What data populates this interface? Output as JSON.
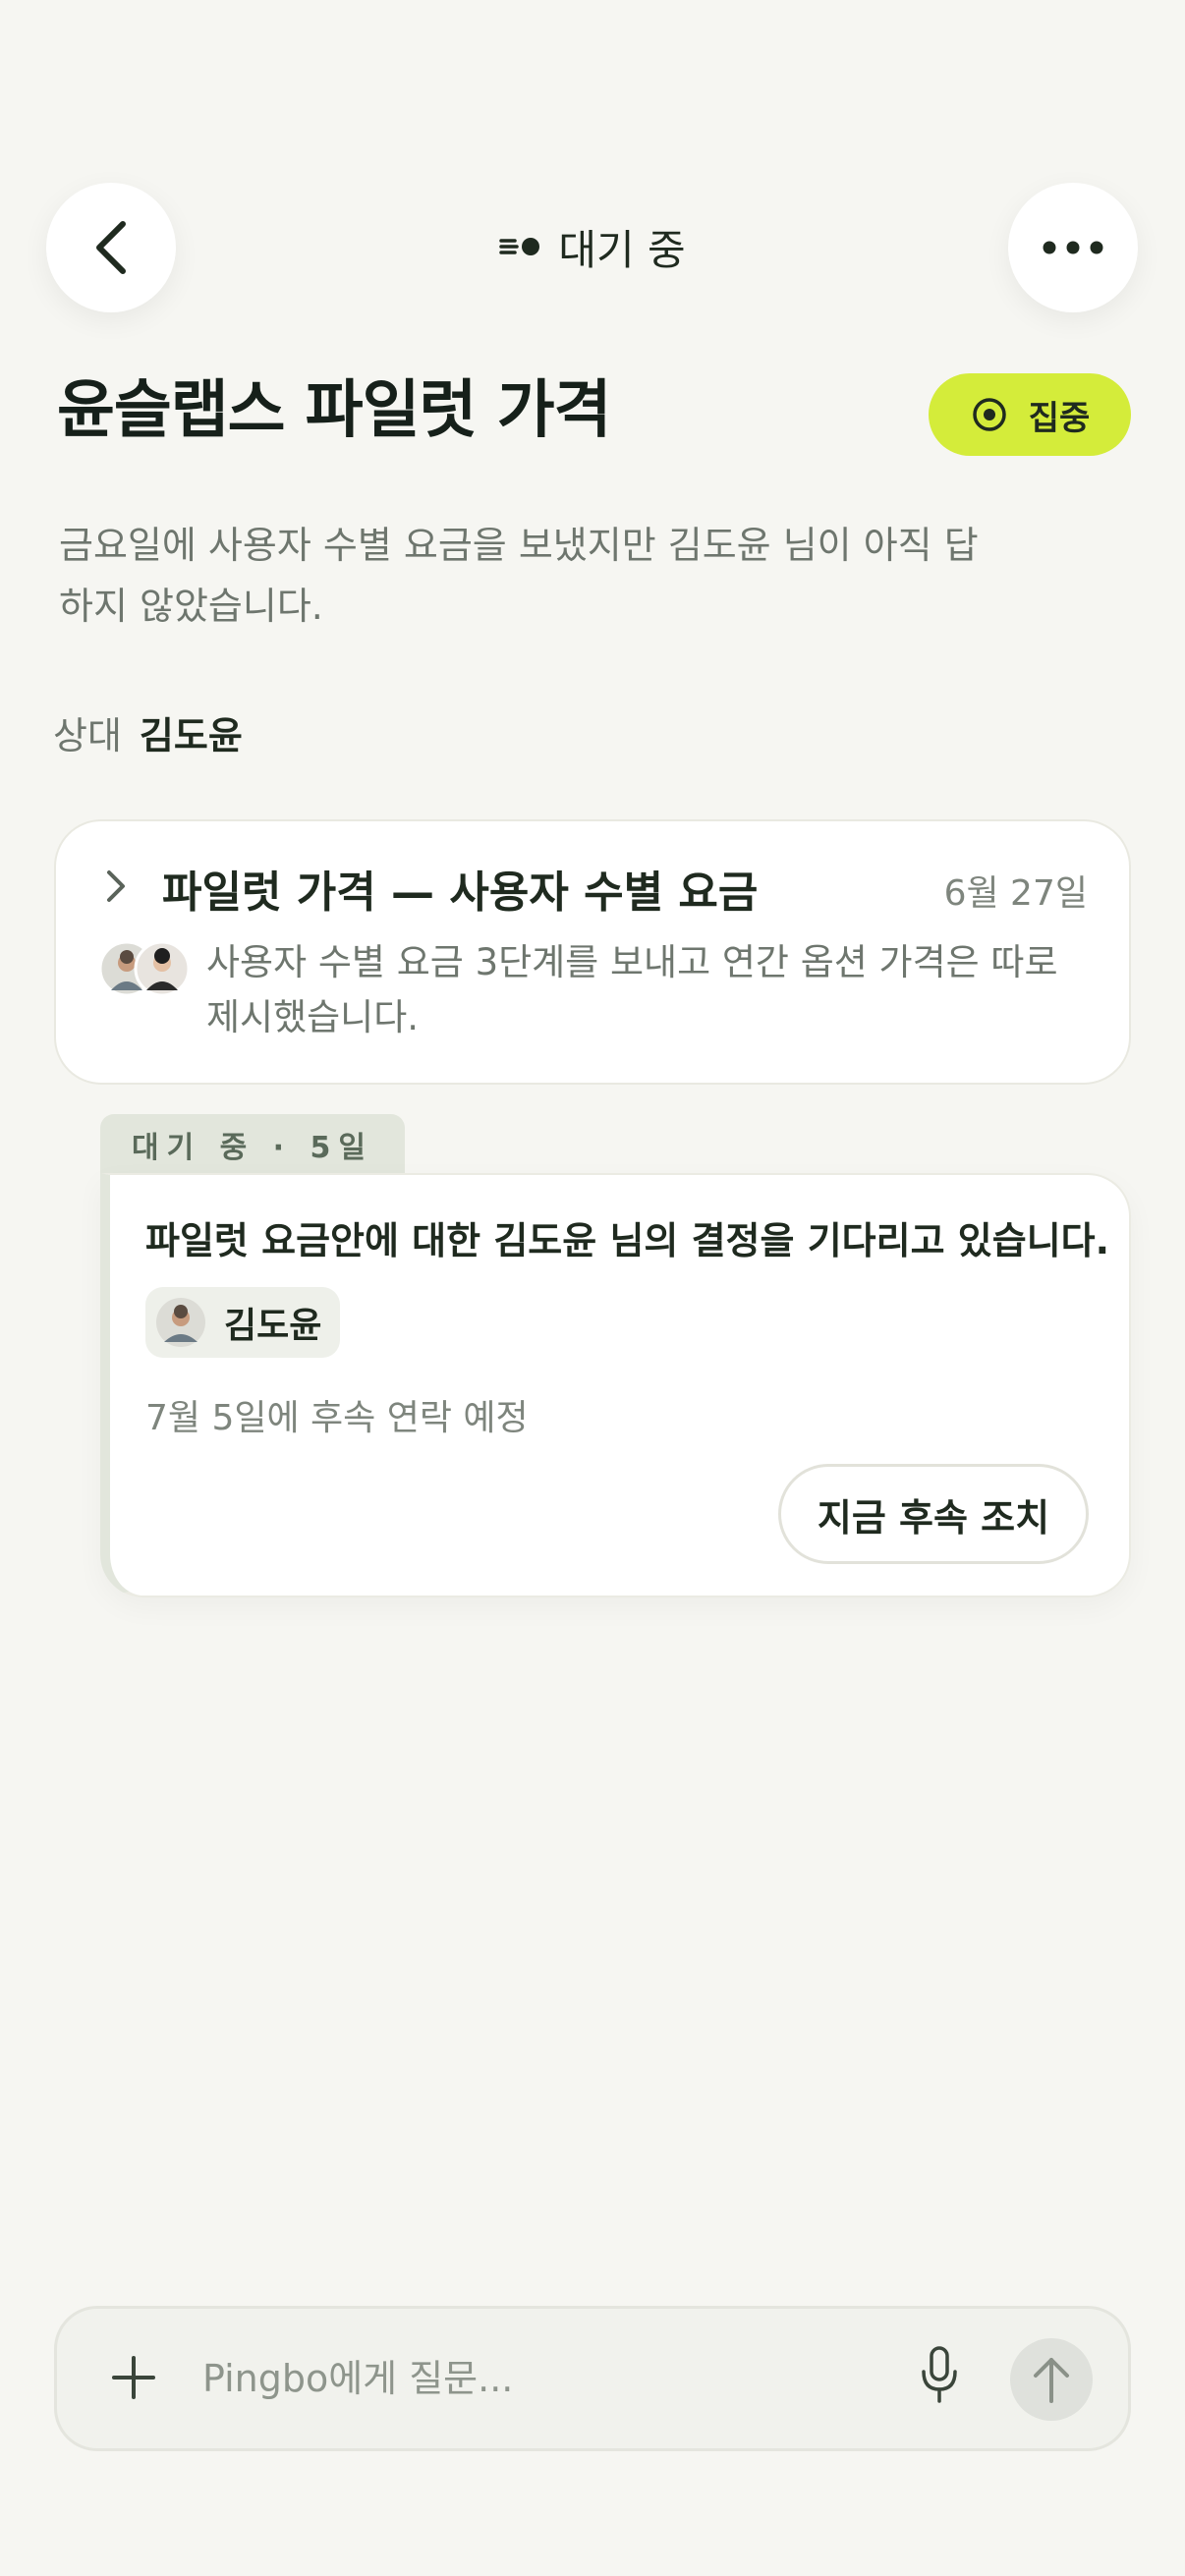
{
  "header": {
    "status_label": "대기 중",
    "back_icon": "chevron-left-icon",
    "more_icon": "more-horizontal-icon",
    "status_icon": "waiting-dot-icon"
  },
  "page": {
    "title": "윤슬랩스 파일럿 가격",
    "focus_label": "집중",
    "focus_color": "#d4ec3a",
    "description": "금요일에 사용자 수별 요금을 보냈지만 김도윤 님이 아직 답하지 않았습니다.",
    "counterpart_label": "상대",
    "counterpart_name": "김도윤"
  },
  "thread": {
    "title": "파일럿 가격 — 사용자 수별 요금",
    "date": "6월 27일",
    "summary": "사용자 수별 요금 3단계를 보내고 연간 옵션 가격은 따로 제시했습니다."
  },
  "waiting": {
    "tab_label": "대기 중 · 5일",
    "message": "파일럿 요금안에 대한 김도윤 님의 결정을 기다리고 있습니다.",
    "person_name": "김도윤",
    "followup_note": "7월 5일에 후속 연락 예정",
    "followup_button": "지금 후속 조치"
  },
  "composer": {
    "placeholder": "Pingbo에게 질문..."
  }
}
